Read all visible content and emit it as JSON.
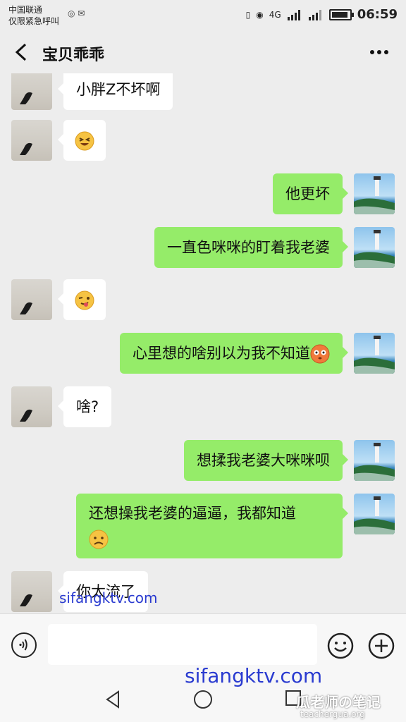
{
  "status_bar": {
    "carrier_line1": "中国联通",
    "carrier_line2": "仅限紧急呼叫",
    "time": "06:59",
    "signal_label": "4G"
  },
  "header": {
    "title": "宝贝乖乖"
  },
  "messages": [
    {
      "side": "left",
      "text": "小胖Z不坏啊"
    },
    {
      "side": "left",
      "text": "",
      "emoji": "grinning-squint-emoji"
    },
    {
      "side": "right",
      "text": "他更坏"
    },
    {
      "side": "right",
      "text": "一直色咪咪的盯着我老婆"
    },
    {
      "side": "left",
      "text": "",
      "emoji": "winking-tongue-emoji"
    },
    {
      "side": "right",
      "text": "心里想的啥别以为我不知道",
      "emoji": "flushed-emoji"
    },
    {
      "side": "left",
      "text": "啥?"
    },
    {
      "side": "right",
      "text": "想揉我老婆大咪咪呗"
    },
    {
      "side": "right",
      "text": "还想操我老婆的逼逼，我都知道",
      "emoji": "frowning-emoji"
    },
    {
      "side": "left",
      "text": "你太流了"
    }
  ],
  "watermarks": {
    "site1": "sifangktv.com",
    "site2": "sifangktv.com",
    "brand": "瓜老师の笔记",
    "brand_url": "teachergua.org"
  },
  "colors": {
    "bubble_right": "#95ec69",
    "bubble_left": "#ffffff",
    "background": "#ededed"
  }
}
